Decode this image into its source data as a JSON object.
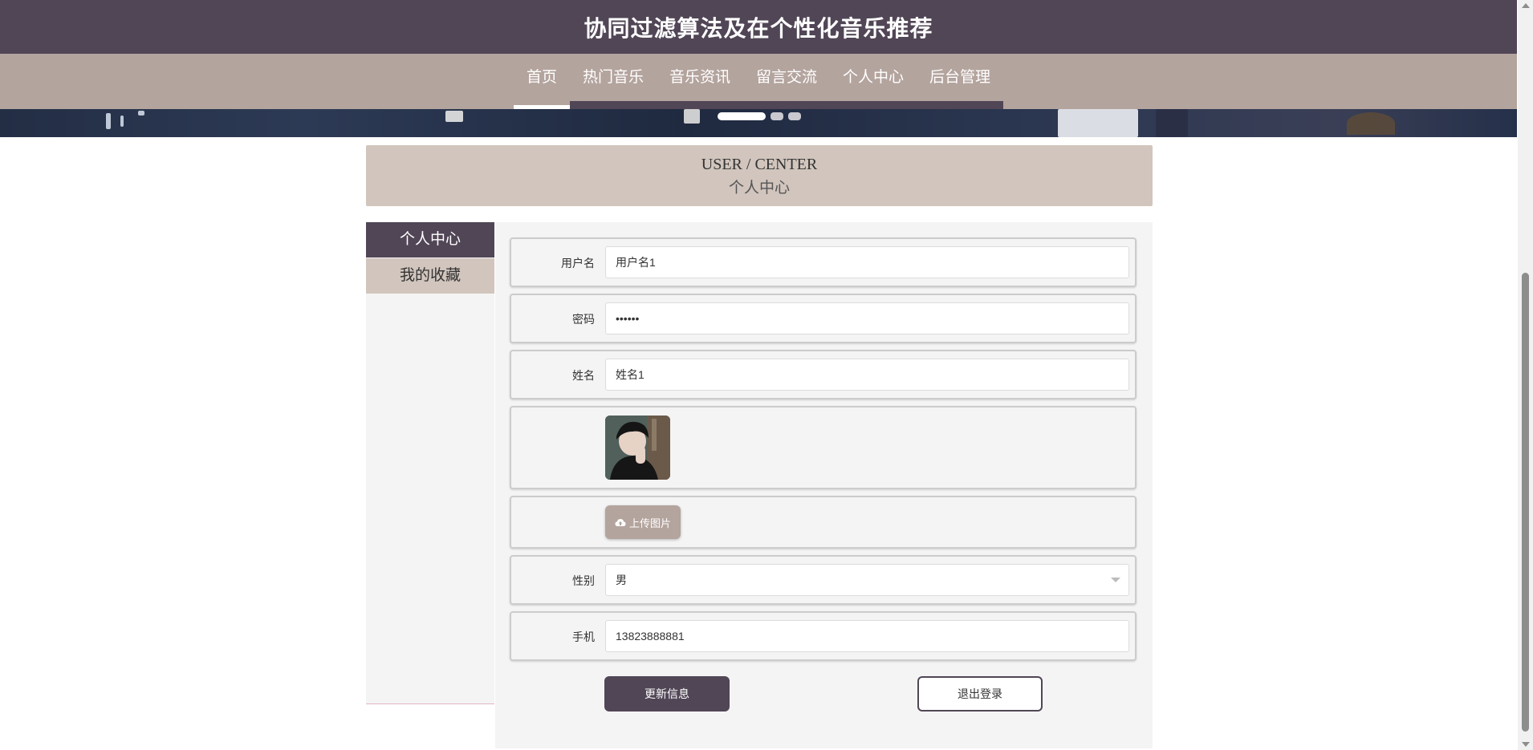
{
  "header": {
    "site_title": "协同过滤算法及在个性化音乐推荐"
  },
  "nav": {
    "items": [
      {
        "label": "首页",
        "active": true
      },
      {
        "label": "热门音乐",
        "active": false
      },
      {
        "label": "音乐资讯",
        "active": false
      },
      {
        "label": "留言交流",
        "active": false
      },
      {
        "label": "个人中心",
        "active": false
      },
      {
        "label": "后台管理",
        "active": false
      }
    ]
  },
  "section": {
    "title_en": "USER / CENTER",
    "title_cn": "个人中心"
  },
  "sidebar": {
    "items": [
      {
        "label": "个人中心",
        "active": true
      },
      {
        "label": "我的收藏",
        "active": false
      }
    ]
  },
  "form": {
    "username": {
      "label": "用户名",
      "value": "用户名1"
    },
    "password": {
      "label": "密码",
      "value": "••••••"
    },
    "name": {
      "label": "姓名",
      "value": "姓名1"
    },
    "upload": {
      "label": "上传图片"
    },
    "gender": {
      "label": "性别",
      "value": "男"
    },
    "phone": {
      "label": "手机",
      "value": "13823888881"
    }
  },
  "actions": {
    "update_label": "更新信息",
    "logout_label": "退出登录"
  },
  "colors": {
    "primary": "#514656",
    "accent": "#b4a49e",
    "panel": "#d1c5bd"
  }
}
